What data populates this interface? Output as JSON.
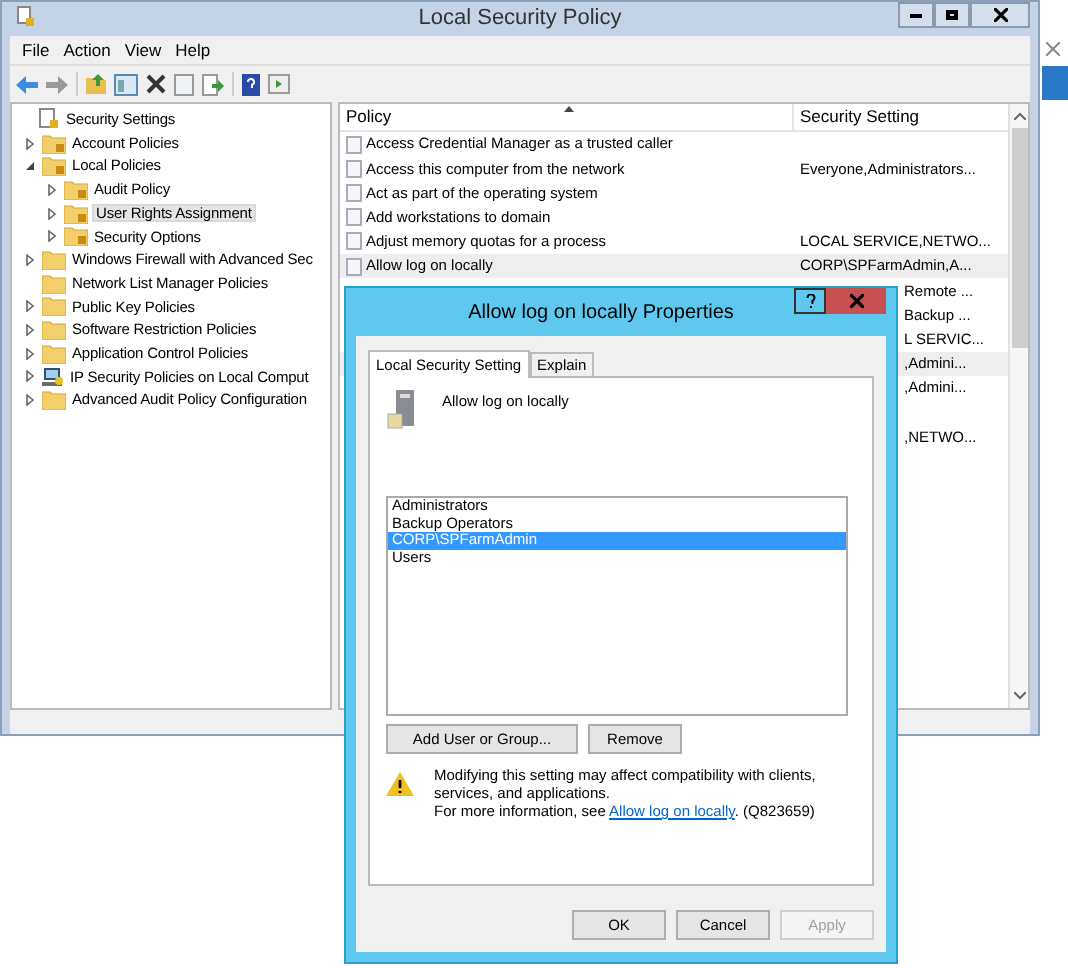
{
  "window": {
    "title": "Local Security Policy"
  },
  "menu": [
    "File",
    "Action",
    "View",
    "Help"
  ],
  "tree": [
    {
      "label": "Security Settings",
      "kind": "root",
      "selected": false,
      "children": [
        {
          "label": "Account Policies",
          "kind": "locked",
          "expanded": false,
          "selected": false
        },
        {
          "label": "Local Policies",
          "kind": "locked",
          "expanded": true,
          "selected": false,
          "children": [
            {
              "label": "Audit Policy",
              "kind": "locked",
              "expanded": false,
              "selected": false
            },
            {
              "label": "User Rights Assignment",
              "kind": "locked",
              "expanded": false,
              "selected": true
            },
            {
              "label": "Security Options",
              "kind": "locked",
              "expanded": false,
              "selected": false
            }
          ]
        },
        {
          "label": "Windows Firewall with Advanced Sec",
          "kind": "folder",
          "expanded": false,
          "selected": false
        },
        {
          "label": "Network List Manager Policies",
          "kind": "folder",
          "selected": false
        },
        {
          "label": "Public Key Policies",
          "kind": "folder",
          "expanded": false,
          "selected": false
        },
        {
          "label": "Software Restriction Policies",
          "kind": "folder",
          "expanded": false,
          "selected": false
        },
        {
          "label": "Application Control Policies",
          "kind": "folder",
          "expanded": false,
          "selected": false
        },
        {
          "label": "IP Security Policies on Local Comput",
          "kind": "ip",
          "expanded": false,
          "selected": false
        },
        {
          "label": "Advanced Audit Policy Configuration",
          "kind": "folder",
          "expanded": false,
          "selected": false
        }
      ]
    }
  ],
  "table": {
    "columns": [
      "Policy",
      "Security Setting"
    ],
    "rows": [
      {
        "policy": "Access Credential Manager as a trusted caller",
        "selected": false
      },
      {
        "policy": "Access this computer from the network",
        "setting": "Everyone,Administrators...",
        "selected": false
      },
      {
        "policy": "Act as part of the operating system",
        "selected": false
      },
      {
        "policy": "Add workstations to domain",
        "selected": false
      },
      {
        "policy": "Adjust memory quotas for a process",
        "setting": "LOCAL SERVICE,NETWO...",
        "selected": false
      },
      {
        "policy": "Allow log on locally",
        "setting": "CORP\\SPFarmAdmin,A...",
        "selected": true
      },
      {
        "setting": "Remote ...",
        "selected": false
      },
      {
        "setting": "Backup ...",
        "selected": false
      },
      {
        "setting": "L SERVIC...",
        "selected": false
      },
      {
        "setting": ",Admini...",
        "selected": true
      },
      {
        "setting": ",Admini...",
        "selected": false
      },
      {
        "selected": false
      },
      {
        "setting": ",NETWO...",
        "selected": false
      }
    ]
  },
  "dialog": {
    "title": "Allow log on locally Properties",
    "tabs": [
      {
        "label": "Local Security Setting",
        "selected": true
      },
      {
        "label": "Explain",
        "selected": false
      }
    ],
    "heading": "Allow log on locally",
    "members": [
      {
        "name": "Administrators",
        "selected": false
      },
      {
        "name": "Backup Operators",
        "selected": false
      },
      {
        "name": "CORP\\SPFarmAdmin",
        "selected": true
      },
      {
        "name": "Users",
        "selected": false
      }
    ],
    "add_button": "Add User or Group...",
    "remove_button": "Remove",
    "warning": "Modifying this setting may affect compatibility with clients, services, and applications.",
    "info": "For more information, see",
    "link": "Allow log on locally",
    "info_suffix": ". (Q823659)",
    "buttons": [
      {
        "label": "OK",
        "disabled": false
      },
      {
        "label": "Cancel",
        "disabled": false
      },
      {
        "label": "Apply",
        "disabled": true
      }
    ]
  }
}
